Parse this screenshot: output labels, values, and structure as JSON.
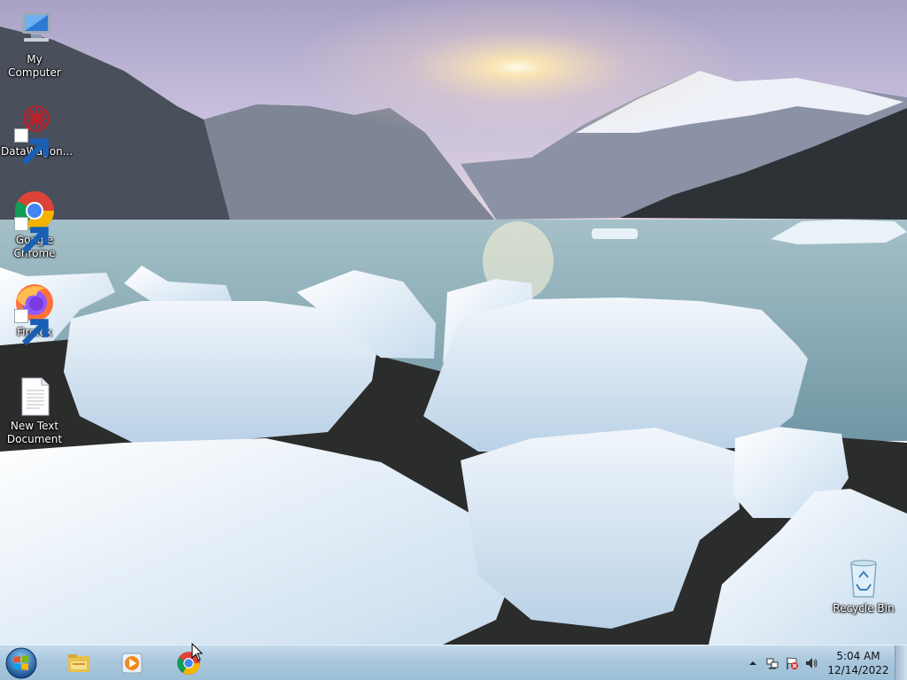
{
  "desktop": {
    "icons": [
      {
        "label": "My Computer",
        "icon": "computer-icon"
      },
      {
        "label": "DataWagon...",
        "icon": "datawagon-icon"
      },
      {
        "label": "Google Chrome",
        "icon": "chrome-icon"
      },
      {
        "label": "Firefox",
        "icon": "firefox-icon"
      },
      {
        "label": "New Text Document",
        "icon": "text-document-icon"
      },
      {
        "label": "Recycle Bin",
        "icon": "recycle-bin-icon"
      }
    ]
  },
  "taskbar": {
    "start": {
      "icon": "windows-start-icon"
    },
    "pinned": [
      {
        "icon": "file-explorer-icon"
      },
      {
        "icon": "media-player-icon"
      },
      {
        "icon": "chrome-icon"
      }
    ],
    "tray": {
      "icons": [
        "show-hidden-icons-arrow",
        "network-icon",
        "action-center-flag-icon",
        "volume-icon"
      ],
      "time": "5:04 AM",
      "date": "12/14/2022"
    }
  },
  "colors": {
    "taskbar": "#a9c7dd",
    "sky": "#b4aacb",
    "water": "#7fa6b4",
    "ice": "#e4eef7"
  }
}
